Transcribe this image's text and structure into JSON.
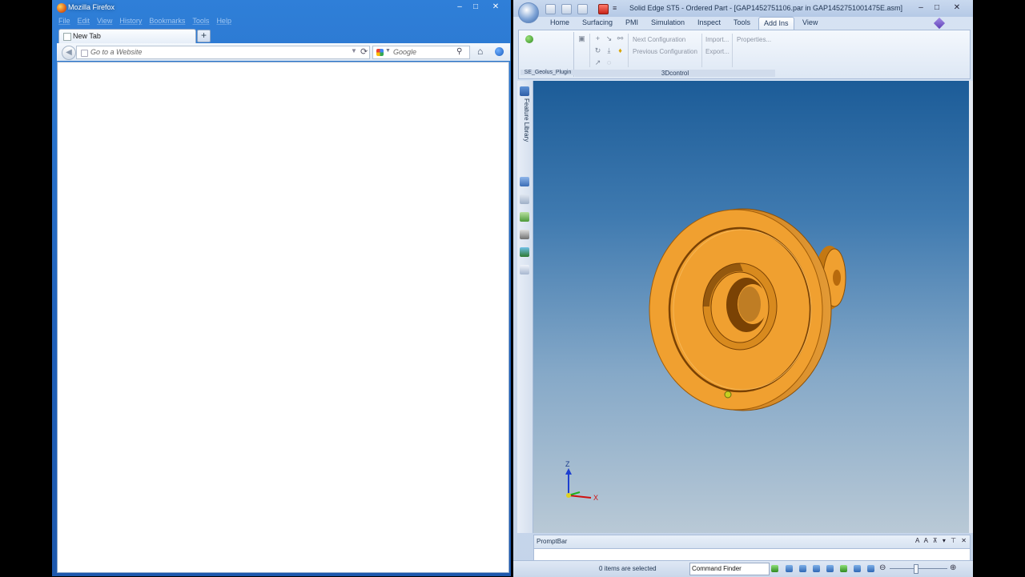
{
  "firefox": {
    "title": "Mozilla Firefox",
    "menu": [
      "File",
      "Edit",
      "View",
      "History",
      "Bookmarks",
      "Tools",
      "Help"
    ],
    "tab_label": "New Tab",
    "new_tab_symbol": "+",
    "url_placeholder": "Go to a Website",
    "search_placeholder": "Google",
    "window_buttons": [
      "–",
      "□",
      "✕"
    ]
  },
  "solidedge": {
    "title": "Solid Edge ST5 - Ordered Part - [GAP1452751106.par in GAP1452751001475E.asm]",
    "tabs": [
      "Home",
      "Surfacing",
      "PMI",
      "Simulation",
      "Inspect",
      "Tools",
      "Add Ins",
      "View"
    ],
    "window_buttons": [
      "–",
      "□",
      "✕"
    ],
    "ribbon": {
      "group1_label": "SE_Geolus_Plugin",
      "group2_label": "3Dcontrol",
      "next_configuration": "Next Configuration",
      "previous_configuration": "Previous Configuration",
      "import": "Import...",
      "export": "Export...",
      "properties": "Properties..."
    },
    "feature_library": "Feature Library",
    "axes": {
      "z": "Z",
      "x": "X"
    },
    "part_color": "#f0a030",
    "prompt_bar": {
      "title": "PromptBar",
      "controls": "A A ⊼ ▾ ⊤ ✕"
    },
    "status": {
      "selection": "0 items are selected",
      "command_finder": "Command Finder"
    }
  }
}
